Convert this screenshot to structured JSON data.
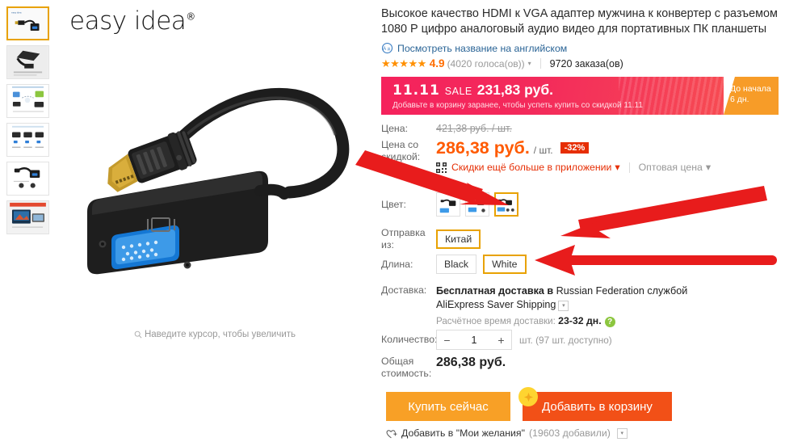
{
  "gallery": {
    "thumbnails": [
      {
        "name": "adapter-front",
        "selected": true
      },
      {
        "name": "adapter-closeup",
        "selected": false
      },
      {
        "name": "connection-diagram",
        "selected": false
      },
      {
        "name": "variants-row",
        "selected": false
      },
      {
        "name": "adapter-pair",
        "selected": false
      },
      {
        "name": "laptop-tv-usage",
        "selected": false
      }
    ]
  },
  "product_image": {
    "brand": "easy idea",
    "brand_mark": "®",
    "zoom_hint": "Наведите курсор, чтобы увеличить",
    "zoom_icon": "magnifier-icon"
  },
  "info": {
    "title": "Высокое качество HDMI к VGA адаптер мужчина к конвертер с разъемом 1080 Р цифро аналоговый аудио видео для портативных ПК планшеты",
    "translate_link": "Посмотреть название на английском",
    "translate_icon": "translate-icon",
    "rating": {
      "stars": "★★★★★",
      "value": "4.9",
      "votes": "(4020 голоса(ов))",
      "caret": "▾",
      "orders": "9720 заказа(ов)"
    }
  },
  "sale_banner": {
    "eleven": "11.11",
    "sale_word": "SALE",
    "price": "231,83 руб.",
    "subtitle": "Добавьте в корзину заранее, чтобы успеть купить со скидкой 11.11",
    "countdown_label": "До начала",
    "countdown_value": "6 дн.",
    "colors": {
      "gradient_start": "#f5225c",
      "gradient_end": "#f74b52",
      "side": "#f79c28"
    }
  },
  "price": {
    "price_label": "Цена:",
    "old_price": "421,38 руб. / шт.",
    "discount_label_l1": "Цена со",
    "discount_label_l2": "скидкой:",
    "new_price": "286,38 руб.",
    "per_unit": "/ шт.",
    "discount_badge": "-32%",
    "app_discount": "Скидки ещё больше в приложении",
    "app_caret": "▾",
    "wholesale": "Оптовая цена",
    "wholesale_caret": "▾",
    "qr_icon": "qr-code-icon",
    "accent": "#ff5a00"
  },
  "options": {
    "color_label": "Цвет:",
    "color_swatches": [
      {
        "name": "swatch-1",
        "selected": false
      },
      {
        "name": "swatch-2",
        "selected": false
      },
      {
        "name": "swatch-3",
        "selected": true
      }
    ],
    "ship_label": "Отправка из:",
    "ship_options": [
      {
        "label": "Китай",
        "selected": true
      }
    ],
    "length_label": "Длина:",
    "length_options": [
      {
        "label": "Black",
        "selected": false
      },
      {
        "label": "White",
        "selected": true
      }
    ],
    "selected_border": "#e8a202"
  },
  "delivery": {
    "label": "Доставка:",
    "free_bold": "Бесплатная доставка в",
    "destination": "Russian Federation службой",
    "carrier": "AliExpress Saver Shipping",
    "dropdown_caret": "▾",
    "est_label": "Расчётное время доставки:",
    "est_value": "23-32 дн.",
    "help_icon": "question-mark-icon"
  },
  "quantity": {
    "label": "Количество:",
    "minus": "−",
    "plus": "+",
    "value": "1",
    "note": "шт. (97 шт. доступно)"
  },
  "total": {
    "label_l1": "Общая",
    "label_l2": "стоимость:",
    "value": "286,38 руб."
  },
  "actions": {
    "buy_now": "Купить сейчас",
    "add_to_cart": "Добавить в корзину",
    "coin_icon": "coin-reward-icon",
    "wishlist": "Добавить в \"Мои желания\"",
    "wishlist_count": "(19603 добавили)",
    "wishlist_caret": "▾",
    "wishlist_icon": "heart-plus-icon",
    "buy_color": "#f8a026",
    "cart_color": "#f25017"
  },
  "annotations": {
    "arrow_color": "#e81c1c",
    "arrows": [
      {
        "name": "arrow-to-color-swatch",
        "target": "color swatch 3"
      },
      {
        "name": "arrow-to-ship-from",
        "target": "Китай"
      },
      {
        "name": "arrow-to-length",
        "target": "White"
      }
    ]
  }
}
